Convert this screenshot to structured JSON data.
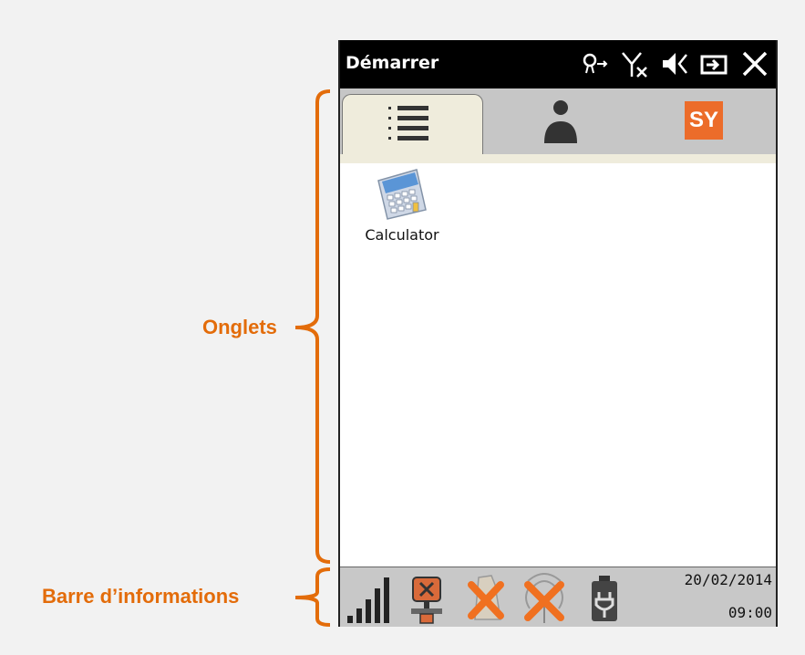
{
  "annotations": {
    "tabs_label": "Onglets",
    "infobar_label": "Barre d’informations"
  },
  "titlebar": {
    "title": "Démarrer",
    "icons": [
      "connectivity-icon",
      "no-signal-icon",
      "speaker-icon",
      "battery-plug-icon",
      "close-icon"
    ]
  },
  "tabs": [
    {
      "name": "list",
      "icon": "list-icon",
      "active": true
    },
    {
      "name": "user",
      "icon": "user-icon",
      "active": false
    },
    {
      "name": "sy",
      "icon": "sy-logo-icon",
      "label": "SY",
      "active": false
    }
  ],
  "apps": [
    {
      "label": "Calculator",
      "icon": "calculator-icon"
    }
  ],
  "infobar": {
    "icons": [
      "signal-bars-icon",
      "gps-disabled-icon",
      "scanner-disabled-icon",
      "wireless-disabled-icon",
      "battery-icon"
    ],
    "date": "20/02/2014",
    "time": "09:00"
  },
  "colors": {
    "annotation": "#e36c0a",
    "titlebar": "#000000",
    "tab_active": "#efecdc",
    "tab_strip": "#c6c6c6",
    "infobar": "#c8c8c8"
  }
}
